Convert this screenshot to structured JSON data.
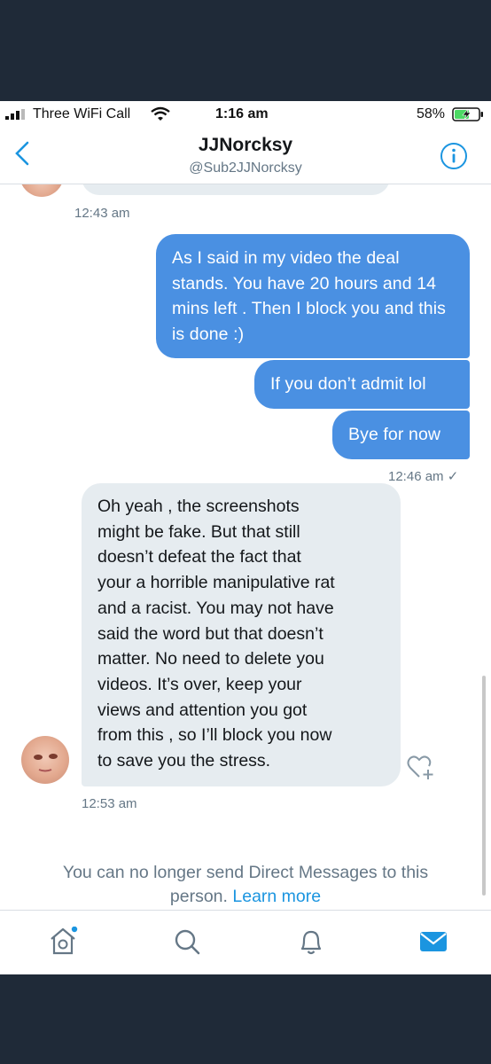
{
  "status_bar": {
    "carrier": "Three WiFi Call",
    "time": "1:16 am",
    "battery_percent": "58%"
  },
  "header": {
    "name": "JJNorcksy",
    "handle": "@Sub2JJNorcksy",
    "back_icon": "chevron-left-icon",
    "info_icon": "info-icon"
  },
  "messages": {
    "prev_timestamp": "12:43 am",
    "outgoing": [
      "As I said in my video the deal stands. You have 20 hours and 14 mins left . Then I block you and this is done :)",
      "If you don’t admit lol",
      "Bye for now"
    ],
    "outgoing_timestamp": "12:46 am ✓",
    "incoming": "Oh yeah , the screenshots\nmight be fake. But that still\ndoesn’t defeat the fact that\nyour a horrible manipulative rat\nand a racist. You may not have\nsaid the word but that doesn’t\nmatter. No need to delete you\nvideos. It’s over, keep your\nviews and attention you got\nfrom this , so I’ll block you now\nto save you the stress.",
    "incoming_timestamp": "12:53 am"
  },
  "notice": {
    "text": "You can no longer send Direct Messages to this\nperson.",
    "link": "Learn more"
  },
  "tabbar": {
    "items": [
      "home-icon",
      "search-icon",
      "notifications-icon",
      "messages-icon"
    ],
    "active": "messages-icon"
  },
  "colors": {
    "accent": "#1b95e0",
    "outgoing_bubble": "#4a90e2",
    "incoming_bubble": "#e6ecf0",
    "frame": "#1f2a38"
  }
}
